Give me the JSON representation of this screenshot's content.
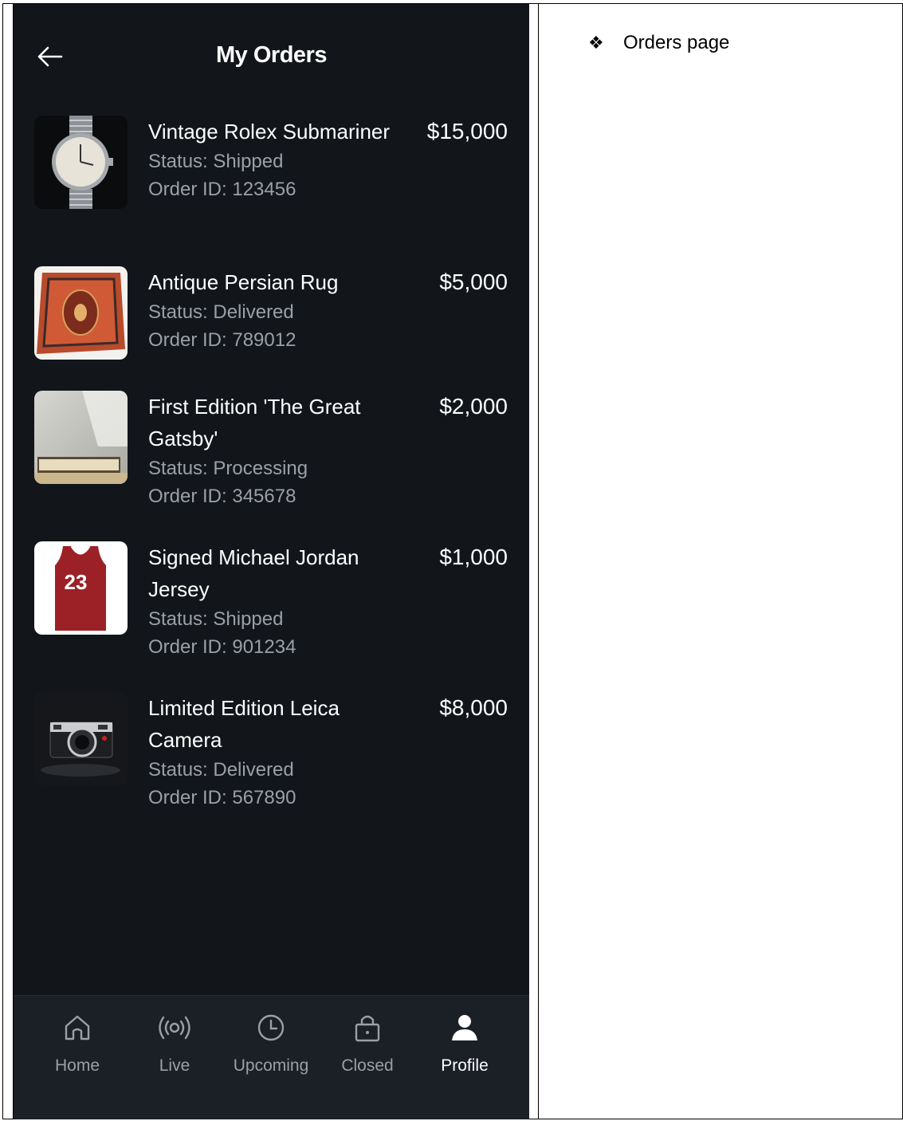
{
  "header": {
    "title": "My Orders"
  },
  "orders": [
    {
      "name": "Vintage Rolex Submariner",
      "status": "Status: Shipped",
      "order_id": "Order ID: 123456",
      "price": "$15,000",
      "image": "watch-image"
    },
    {
      "name": "Antique Persian Rug",
      "status": "Status: Delivered",
      "order_id": "Order ID: 789012",
      "price": "$5,000",
      "image": "rug-image"
    },
    {
      "name": "First Edition 'The Great Gatsby'",
      "status": "Status: Processing",
      "order_id": "Order ID: 345678",
      "price": "$2,000",
      "image": "book-image"
    },
    {
      "name": "Signed Michael Jordan Jersey",
      "status": "Status: Shipped",
      "order_id": "Order ID: 901234",
      "price": "$1,000",
      "image": "jersey-image",
      "jersey_number": "23"
    },
    {
      "name": "Limited Edition Leica Camera",
      "status": "Status: Delivered",
      "order_id": "Order ID: 567890",
      "price": "$8,000",
      "image": "camera-image"
    }
  ],
  "nav": [
    {
      "label": "Home",
      "icon": "home-icon",
      "active": false
    },
    {
      "label": "Live",
      "icon": "live-icon",
      "active": false
    },
    {
      "label": "Upcoming",
      "icon": "clock-icon",
      "active": false
    },
    {
      "label": "Closed",
      "icon": "lock-icon",
      "active": false
    },
    {
      "label": "Profile",
      "icon": "profile-icon",
      "active": true
    }
  ],
  "annotation": {
    "bullet": "❖",
    "text": "Orders page"
  },
  "colors": {
    "background": "#12161b",
    "navbar": "#1b1f26",
    "text_primary": "#ffffff",
    "text_secondary": "#9aa0a6"
  }
}
